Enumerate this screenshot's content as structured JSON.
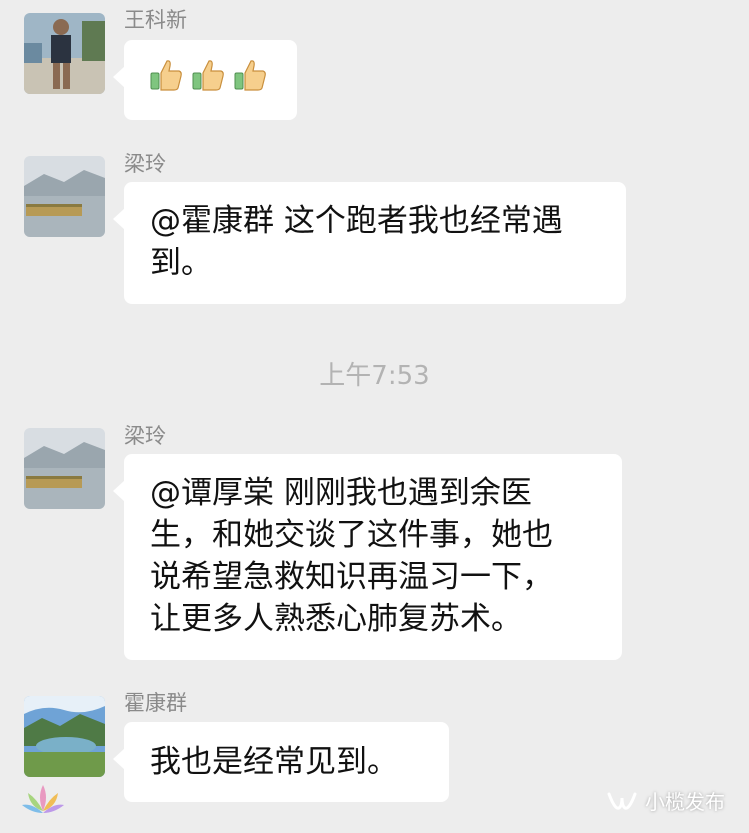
{
  "messages": [
    {
      "sender": "王科新",
      "content": "👍👍👍"
    },
    {
      "sender": "梁玲",
      "lines": [
        "@霍康群 这个跑者我也经常遇",
        "到。"
      ]
    },
    {
      "sender": "梁玲",
      "lines": [
        "@谭厚棠 刚刚我也遇到余医",
        "生，和她交谈了这件事，她也",
        "说希望急救知识再温习一下，",
        "让更多人熟悉心肺复苏术。"
      ]
    },
    {
      "sender": "霍康群",
      "lines": [
        "我也是经常见到。"
      ]
    }
  ],
  "timestamp": "上午7:53",
  "watermark": {
    "text": "小榄发布",
    "icon": "wechat-channel-icon"
  },
  "colors": {
    "background": "#ededed",
    "bubble": "#ffffff",
    "name": "#8a8a8a",
    "time": "#b3b3b3"
  }
}
